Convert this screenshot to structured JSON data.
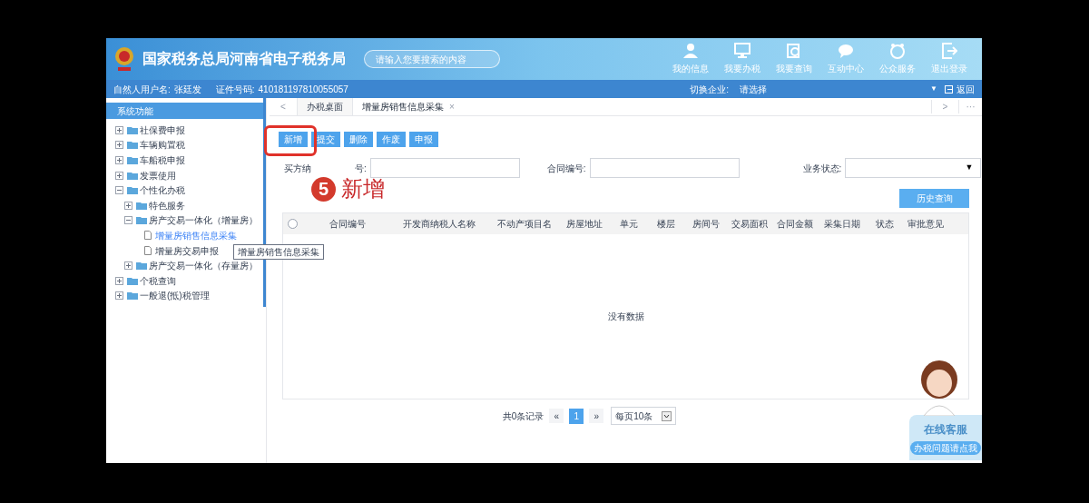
{
  "header": {
    "title": "国家税务总局河南省电子税务局",
    "search": {
      "placeholder": "请输入您要搜索的内容"
    },
    "nav": [
      {
        "label": "我的信息"
      },
      {
        "label": "我要办税"
      },
      {
        "label": "我要查询"
      },
      {
        "label": "互动中心"
      },
      {
        "label": "公众服务"
      },
      {
        "label": "退出登录"
      }
    ]
  },
  "user_bar": {
    "user_label": "自然人用户名:",
    "user_name": "张廷发",
    "id_label": "证件号码:",
    "id_number": "410181197810055057",
    "switch_label": "切换企业:",
    "switch_value": "请选择",
    "dropdown": "▼",
    "back": "返回"
  },
  "sidebar": {
    "title": "系统功能",
    "items": [
      {
        "label": "社保费申报",
        "expanded": false,
        "selected": false
      },
      {
        "label": "车辆购置税",
        "expanded": false,
        "selected": false
      },
      {
        "label": "车船税申报",
        "expanded": false,
        "selected": false
      },
      {
        "label": "发票使用",
        "expanded": false,
        "selected": false
      },
      {
        "label": "个性化办税",
        "expanded": true,
        "selected": false,
        "children": [
          {
            "label": "特色服务",
            "expanded": false,
            "selected": false
          },
          {
            "label": "房产交易一体化（增量房）",
            "expanded": true,
            "selected": false,
            "children": [
              {
                "label": "增量房销售信息采集",
                "kind": "leaf",
                "selected": true
              },
              {
                "label": "增量房交易申报",
                "kind": "leaf",
                "selected": false
              }
            ]
          },
          {
            "label": "房产交易一体化（存量房）",
            "expanded": false,
            "selected": false
          }
        ]
      },
      {
        "label": "个税查询",
        "expanded": false,
        "selected": false
      },
      {
        "label": "一般退(抵)税管理",
        "expanded": false,
        "selected": false
      }
    ],
    "tooltip": "增量房销售信息采集"
  },
  "tabs": [
    {
      "label": "办税桌面",
      "selected": false
    },
    {
      "label": "增量房销售信息采集",
      "selected": true,
      "close": "×"
    }
  ],
  "tab_nav": {
    "prev": "<",
    "next": ">",
    "more": "···"
  },
  "toolbar": [
    "新增",
    "提交",
    "删除",
    "作废",
    "申报"
  ],
  "annotation": {
    "number": "5",
    "text": "新增"
  },
  "filters": {
    "buyer_label_start": "买方纳",
    "buyer_label_end": "号:",
    "contract_label": "合同编号:",
    "status_label": "业务状态:",
    "status_caret": "▼",
    "history_button": "历史查询"
  },
  "table": {
    "select_all_checked": false,
    "columns": [
      "合同编号",
      "开发商纳税人名称",
      "不动产项目名",
      "房屋地址",
      "单元",
      "楼层",
      "房间号",
      "交易面积",
      "合同金额",
      "采集日期",
      "状态",
      "审批意见"
    ],
    "empty": "没有数据"
  },
  "pagination": {
    "total": "共0条记录",
    "prev": "«",
    "pages": [
      {
        "label": "1",
        "selected": true
      }
    ],
    "next": "»",
    "page_size": "每页10条"
  },
  "chat": {
    "title": "在线客服",
    "subtitle": "办税问题请点我"
  }
}
